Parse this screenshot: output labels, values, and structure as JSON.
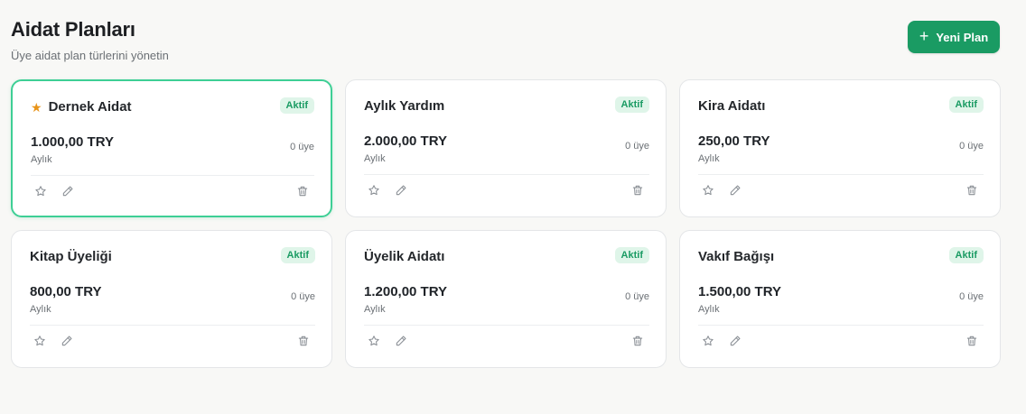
{
  "header": {
    "title": "Aidat Planları",
    "subtitle": "Üye aidat plan türlerini yönetin",
    "new_button_label": "Yeni Plan"
  },
  "plans": [
    {
      "name": "Dernek Aidat",
      "price": "1.000,00 TRY",
      "period": "Aylık",
      "members": "0 üye",
      "status": "Aktif",
      "default": true
    },
    {
      "name": "Aylık Yardım",
      "price": "2.000,00 TRY",
      "period": "Aylık",
      "members": "0 üye",
      "status": "Aktif",
      "default": false
    },
    {
      "name": "Kira Aidatı",
      "price": "250,00 TRY",
      "period": "Aylık",
      "members": "0 üye",
      "status": "Aktif",
      "default": false
    },
    {
      "name": "Kitap Üyeliği",
      "price": "800,00 TRY",
      "period": "Aylık",
      "members": "0 üye",
      "status": "Aktif",
      "default": false
    },
    {
      "name": "Üyelik Aidatı",
      "price": "1.200,00 TRY",
      "period": "Aylık",
      "members": "0 üye",
      "status": "Aktif",
      "default": false
    },
    {
      "name": "Vakıf Bağışı",
      "price": "1.500,00 TRY",
      "period": "Aylık",
      "members": "0 üye",
      "status": "Aktif",
      "default": false
    }
  ],
  "icons": {
    "new_button": "plus-icon",
    "default_marker": "star-filled-icon",
    "actions": [
      "star-outline-icon",
      "pencil-icon",
      "trash-icon"
    ]
  },
  "colors": {
    "accent": "#1a9b63",
    "badge_bg": "#dff5e9",
    "star": "#e8941a",
    "selected_border": "#3ecf95"
  }
}
